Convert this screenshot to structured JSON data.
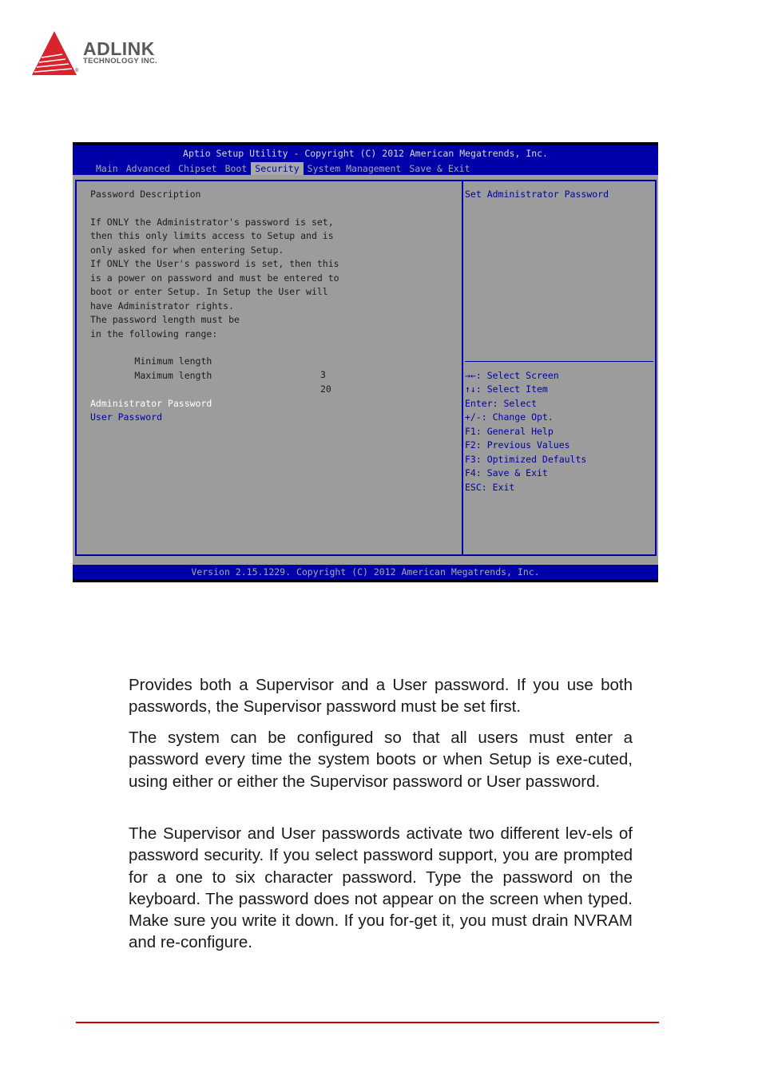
{
  "header": {
    "logo": {
      "name": "ADLINK",
      "subtitle": "TECHNOLOGY INC.",
      "registered": "®",
      "brand_color": "#d9232d"
    }
  },
  "bios": {
    "title": "Aptio Setup Utility - Copyright (C) 2012 American Megatrends, Inc.",
    "tabs": [
      {
        "label": "Main",
        "active": false
      },
      {
        "label": "Advanced",
        "active": false
      },
      {
        "label": "Chipset",
        "active": false
      },
      {
        "label": "Boot",
        "active": false
      },
      {
        "label": "Security",
        "active": true
      },
      {
        "label": "System Management",
        "active": false
      },
      {
        "label": "Save & Exit",
        "active": false
      }
    ],
    "left_pane": {
      "heading": "Password Description",
      "description_lines": [
        "If ONLY the Administrator's password is set,",
        "then this only limits access to Setup and is",
        "only asked for when entering Setup.",
        "If ONLY the User's password is set, then this",
        "is a power on password and must be entered to",
        "boot or enter Setup. In Setup the User will",
        "have Administrator rights.",
        "The password length must be",
        "in the following range:"
      ],
      "settings": [
        {
          "label": "Minimum length",
          "value": "3"
        },
        {
          "label": "Maximum length",
          "value": "20"
        }
      ],
      "menu_items": [
        {
          "label": "Administrator Password",
          "selected": true
        },
        {
          "label": "User Password",
          "selected": false
        }
      ]
    },
    "right_pane": {
      "help_text": "Set Administrator Password",
      "key_help": [
        "→←: Select Screen",
        "↑↓: Select Item",
        "Enter: Select",
        "+/-: Change Opt.",
        "F1: General Help",
        "F2: Previous Values",
        "F3: Optimized Defaults",
        "F4: Save & Exit",
        "ESC: Exit"
      ]
    },
    "footer": "Version 2.15.1229. Copyright (C) 2012 American Megatrends, Inc.",
    "colors": {
      "bar_blue": "#0000a8",
      "panel_gray": "#9c9c9c",
      "highlight": "#ffffff"
    }
  },
  "document": {
    "paragraphs": [
      "Provides both a Supervisor and a User password. If you use both passwords, the Supervisor password must be set first.",
      "The system can be configured so that all users must enter a password every time the system boots or when Setup is exe-cuted, using either or either the Supervisor password or User password.",
      "The Supervisor and User passwords activate two different lev-els of password security. If you select password support, you are prompted for a one to six character password. Type the password on the keyboard. The password does not appear on the screen when typed. Make sure you write it down. If you for-get it, you must drain NVRAM and re-configure."
    ],
    "footer_rule_color": "#cc0000"
  }
}
